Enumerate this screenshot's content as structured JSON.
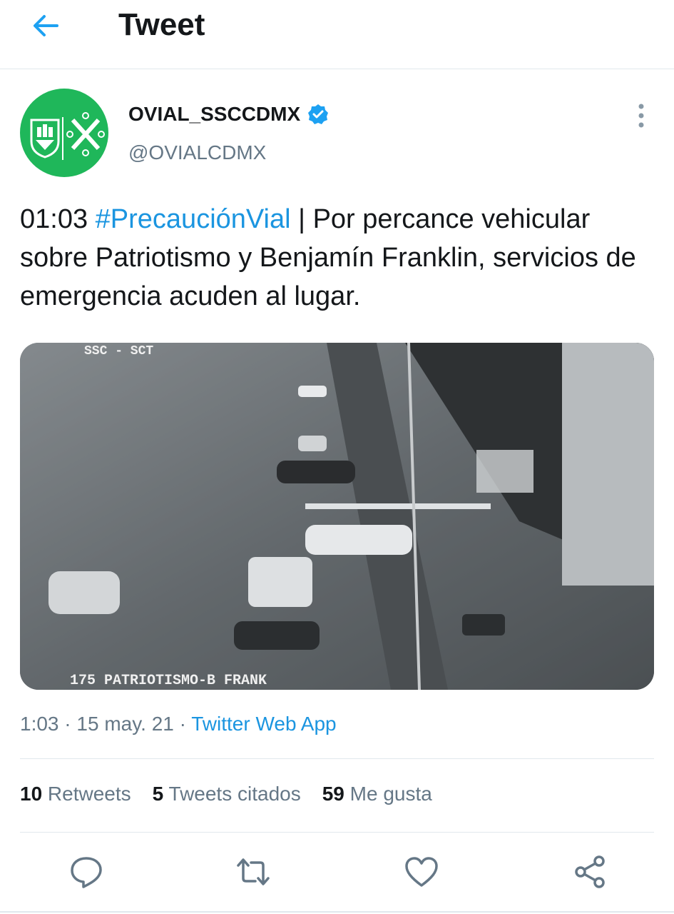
{
  "header": {
    "title": "Tweet",
    "back_icon": "arrow-left-icon"
  },
  "author": {
    "name": "OVIAL_SSCCDMX",
    "handle": "@OVIALCDMX",
    "verified": true
  },
  "tweet": {
    "time_prefix": "01:03 ",
    "hashtag": "#PrecauciónVial",
    "text": " | Por percance vehicular sobre Patriotismo y Benjamín Franklin, servicios de emergencia acuden al lugar."
  },
  "media": {
    "overlay_top": "SSC - SCT",
    "overlay_bottom": "175 PATRIOTISMO-B FRANK"
  },
  "meta": {
    "time": "1:03",
    "sep1": " · ",
    "date": "15 may. 21",
    "sep2": " · ",
    "source": "Twitter Web App"
  },
  "stats": {
    "retweets_count": "10",
    "retweets_label": " Retweets",
    "quotes_count": "5",
    "quotes_label": " Tweets citados",
    "likes_count": "59",
    "likes_label": " Me gusta"
  },
  "actions": [
    "reply-icon",
    "retweet-icon",
    "like-icon",
    "share-icon"
  ],
  "colors": {
    "accent": "#1b95e0",
    "avatar_bg": "#1fb75a",
    "muted": "#657786",
    "text": "#14171a"
  }
}
